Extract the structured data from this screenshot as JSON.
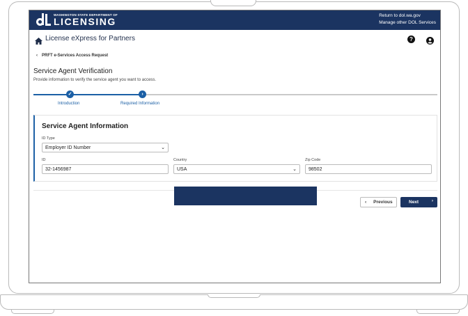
{
  "header": {
    "logo_subtitle": "WASHINGTON STATE DEPARTMENT OF",
    "logo_title": "LICENSING",
    "links": [
      "Return to dol.wa.gov",
      "Manage other DOL Services"
    ]
  },
  "appbar": {
    "title": "License eXpress for Partners",
    "icons": [
      "home-icon",
      "help-icon",
      "user-account-icon"
    ]
  },
  "breadcrumb": {
    "back_label": "PRFT e-Services Access Request"
  },
  "page": {
    "title": "Service Agent Verification",
    "description": "Provide information to verify the service agent you want to access."
  },
  "stepper": {
    "steps": [
      {
        "label": "Introduction",
        "state": "complete"
      },
      {
        "label": "Required Information",
        "state": "current"
      }
    ]
  },
  "form": {
    "section_title": "Service Agent Information",
    "id_type": {
      "label": "ID Type",
      "value": "Employer ID Number"
    },
    "id": {
      "label": "ID",
      "value": "32-1456987"
    },
    "country": {
      "label": "Country",
      "value": "USA"
    },
    "zip": {
      "label": "Zip Code",
      "value": "98502"
    }
  },
  "actions": {
    "previous_label": "Previous",
    "next_label": "Next"
  },
  "colors": {
    "navy": "#1b3461",
    "accent_blue": "#1b5fa5"
  }
}
